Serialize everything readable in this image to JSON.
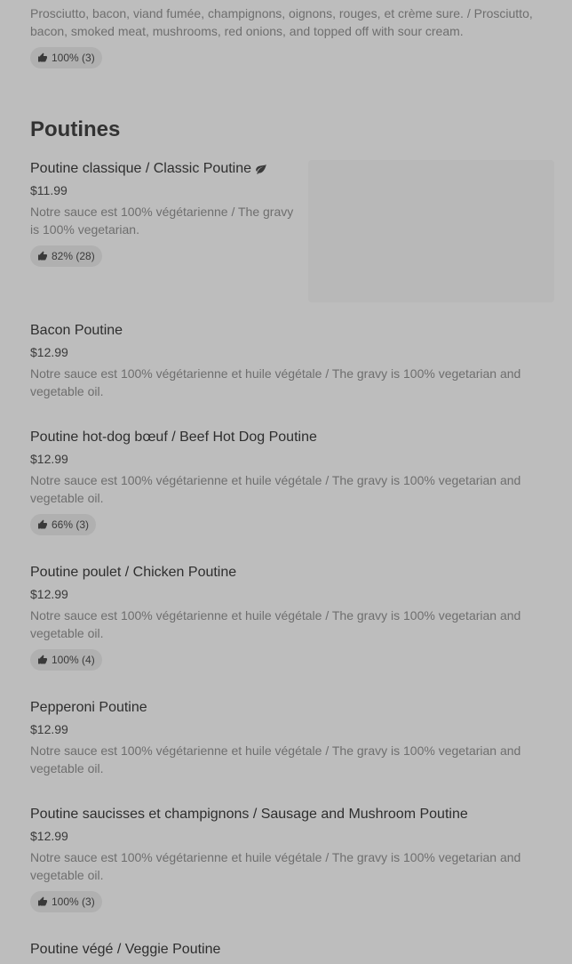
{
  "top_item": {
    "description": "Prosciutto, bacon, viand fumée, champignons, oignons, rouges, et crème sure. / Prosciutto, bacon, smoked meat, mushrooms, red onions, and topped off with sour cream.",
    "rating": "100% (3)"
  },
  "section": {
    "title": "Poutines"
  },
  "items": [
    {
      "name": "Poutine classique / Classic Poutine",
      "price": "$11.99",
      "description": "Notre sauce est 100% végétarienne / The gravy is 100% vegetarian.",
      "rating": "82% (28)",
      "icon": "leaf-icon"
    },
    {
      "name": "Bacon Poutine",
      "price": "$12.99",
      "description": "Notre sauce est 100% végétarienne et huile végétale  / The gravy is 100% vegetarian and vegetable oil."
    },
    {
      "name": "Poutine hot-dog bœuf / Beef Hot Dog Poutine",
      "price": "$12.99",
      "description": "Notre sauce est 100% végétarienne et huile végétale  / The gravy is 100% vegetarian and vegetable oil.",
      "rating": "66% (3)"
    },
    {
      "name": "Poutine poulet / Chicken Poutine",
      "price": "$12.99",
      "description": "Notre sauce est 100% végétarienne et huile végétale  / The gravy is 100% vegetarian and vegetable oil.",
      "rating": "100% (4)"
    },
    {
      "name": "Pepperoni Poutine",
      "price": "$12.99",
      "description": "Notre sauce est 100% végétarienne et huile végétale  / The gravy is 100% vegetarian and vegetable oil."
    },
    {
      "name": "Poutine saucisses et champignons / Sausage and Mushroom Poutine",
      "price": "$12.99",
      "description": "Notre sauce est 100% végétarienne et huile végétale  / The gravy is 100% vegetarian and vegetable oil.",
      "rating": "100% (3)"
    },
    {
      "name": "Poutine végé / Veggie Poutine"
    }
  ]
}
